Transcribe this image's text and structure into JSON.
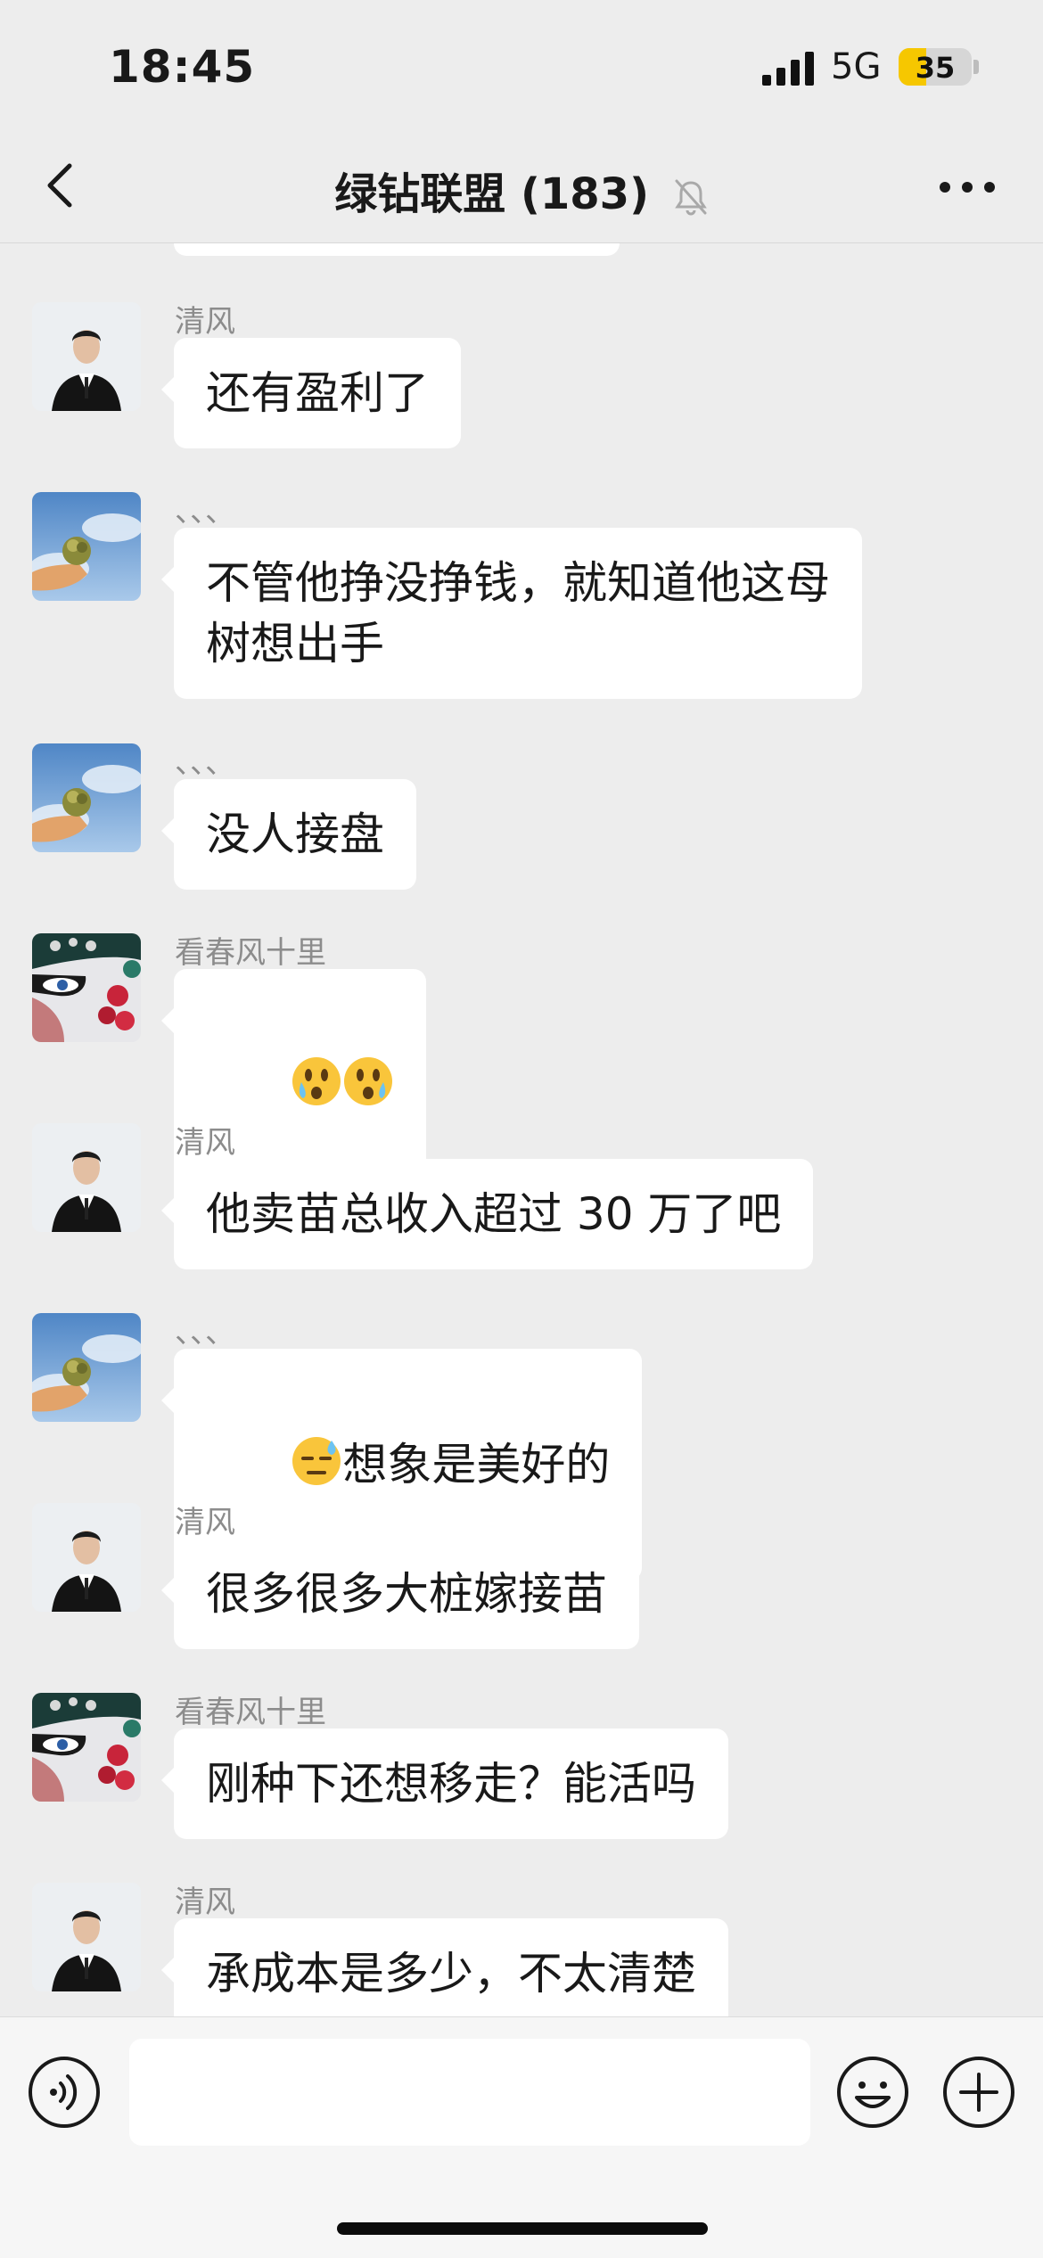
{
  "status": {
    "time": "18:45",
    "network": "5G",
    "battery": "35"
  },
  "header": {
    "title": "绿钻联盟 (183)"
  },
  "messages": [
    {
      "sender": "清风",
      "avatar": "man-in-suit",
      "text": "还有盈利了"
    },
    {
      "sender": "、、、",
      "avatar": "sky-plant",
      "text": "不管他挣没挣钱，就知道他这母\n树想出手"
    },
    {
      "sender": "、、、",
      "avatar": "sky-plant",
      "text": "没人接盘"
    },
    {
      "sender": "看春风十里",
      "avatar": "opera-face",
      "text": "",
      "emojis": [
        "crying-face-emoji",
        "crying-face-emoji"
      ]
    },
    {
      "sender": "清风",
      "avatar": "man-in-suit",
      "text": "他卖苗总收入超过 30 万了吧"
    },
    {
      "sender": "、、、",
      "avatar": "sky-plant",
      "text": "想象是美好的",
      "lead_emoji": "sweat-face-emoji"
    },
    {
      "sender": "清风",
      "avatar": "man-in-suit",
      "text": "很多很多大桩嫁接苗"
    },
    {
      "sender": "看春风十里",
      "avatar": "opera-face",
      "text": "刚种下还想移走？能活吗"
    },
    {
      "sender": "清风",
      "avatar": "man-in-suit",
      "text": "承成本是多少，不太清楚"
    }
  ],
  "input": {
    "value": ""
  },
  "icons": {
    "back": "chevron-left-icon",
    "mute": "muted-bell-icon",
    "more": "more-dots-icon",
    "voice": "voice-icon",
    "emoji": "emoji-icon",
    "plus": "plus-icon"
  }
}
